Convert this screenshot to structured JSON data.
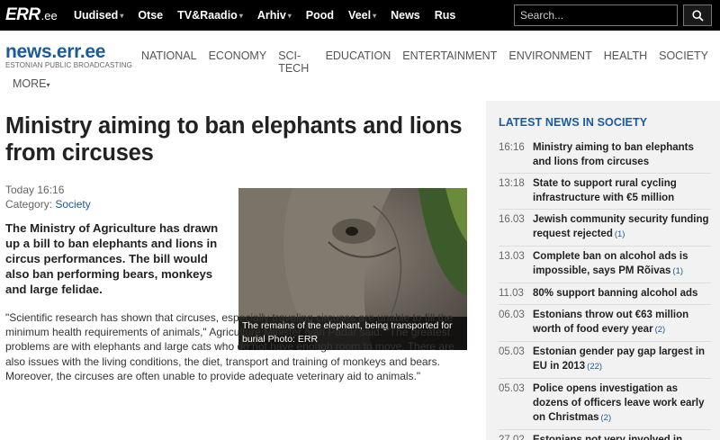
{
  "topbar": {
    "logo_mark": "ERR",
    "logo_suffix": ".ee",
    "nav": [
      {
        "label": "Uudised",
        "caret": true
      },
      {
        "label": "Otse",
        "caret": false
      },
      {
        "label": "TV&Raadio",
        "caret": true
      },
      {
        "label": "Arhiv",
        "caret": true
      },
      {
        "label": "Pood",
        "caret": false
      },
      {
        "label": "Veel",
        "caret": true
      },
      {
        "label": "News",
        "caret": false
      },
      {
        "label": "Rus",
        "caret": false
      }
    ],
    "search_placeholder": "Search...",
    "search_icon": "search-icon"
  },
  "site": {
    "title": "news.err.ee",
    "subtitle": "ESTONIAN PUBLIC BROADCASTING",
    "categories": [
      "NATIONAL",
      "ECONOMY",
      "SCI-TECH",
      "EDUCATION",
      "ENTERTAINMENT",
      "ENVIRONMENT",
      "HEALTH",
      "SOCIETY"
    ],
    "more_label": "MORE"
  },
  "article": {
    "headline": "Ministry aiming to ban elephants and lions from circuses",
    "date": "Today 16:16",
    "category_label": "Category:",
    "category": "Society",
    "lead": "The Ministry of Agriculture has drawn up a bill to ban elephants and lions in circus performances. The bill would also ban performing bears, monkeys and large felidae.",
    "body": "\"Scientific research has shown that circuses, especially traveling circuses are unable to fill the minimum health requirements of animals,\" Agriculture Minister Ivari Padar said. \"The greatest problems are with elephants and large cats who do not have enough room to move. There are also issues with the living conditions, the diet, transport and training of monkeys and bears. Moreover, the circuses are often unable to provide adequate veterinary aid to animals.\"",
    "photo_caption": "The remains of the elephant, being transported for burial Photo: ERR"
  },
  "sidebar": {
    "heading": "LATEST NEWS IN SOCIETY",
    "items": [
      {
        "time": "16:16",
        "title": "Ministry aiming to ban elephants and lions from circuses",
        "count": ""
      },
      {
        "time": "13:18",
        "title": "State to support rural cycling infrastructure with €5 million",
        "count": ""
      },
      {
        "time": "16.03",
        "title": "Jewish community security funding request rejected",
        "count": "(1)"
      },
      {
        "time": "13.03",
        "title": "Complete ban on alcohol ads is impossible, says PM Rõivas",
        "count": "(1)"
      },
      {
        "time": "11.03",
        "title": "80% support banning alcohol ads",
        "count": ""
      },
      {
        "time": "06.03",
        "title": "Estonians throw out €63 million worth of food every year",
        "count": "(2)"
      },
      {
        "time": "05.03",
        "title": "Estonian gender pay gap largest in EU in 2013",
        "count": "(22)"
      },
      {
        "time": "05.03",
        "title": "Police opens investigation as dozens of officers leave work early on Christmas",
        "count": "(2)"
      },
      {
        "time": "27.02",
        "title": "Estonians not very involved in",
        "count": ""
      }
    ]
  },
  "colors": {
    "brand_blue": "#1a5a9e",
    "topbar_bg": "#000000",
    "sidebar_bg": "#f2f2f2"
  }
}
